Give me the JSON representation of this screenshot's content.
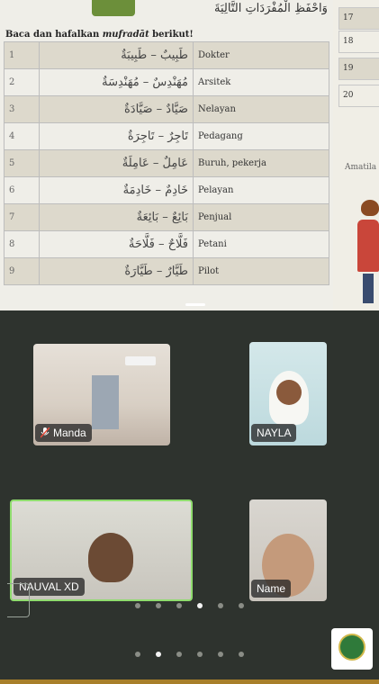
{
  "book": {
    "arabic_header": "وَاحْفَظِ الْمُفْرَدَاتِ التَّالِيَةَ",
    "instruction_prefix": "Baca dan hafalkan ",
    "instruction_term": "mufradāt",
    "instruction_suffix": " berikut!",
    "rows": [
      {
        "num": "1",
        "arabic": "طَبِيبٌ – طَبِيبَةٌ",
        "meaning": "Dokter"
      },
      {
        "num": "2",
        "arabic": "مُهَنْدِسٌ – مُهَنْدِسَةٌ",
        "meaning": "Arsitek"
      },
      {
        "num": "3",
        "arabic": "صَيَّادٌ – صَيَّادَةٌ",
        "meaning": "Nelayan"
      },
      {
        "num": "4",
        "arabic": "تَاجِرٌ – تَاجِرَةٌ",
        "meaning": "Pedagang"
      },
      {
        "num": "5",
        "arabic": "عَامِلٌ – عَامِلَةٌ",
        "meaning": "Buruh, pekerja"
      },
      {
        "num": "6",
        "arabic": "خَادِمٌ – خَادِمَةٌ",
        "meaning": "Pelayan"
      },
      {
        "num": "7",
        "arabic": "بَائِعٌ – بَائِعَةٌ",
        "meaning": "Penjual"
      },
      {
        "num": "8",
        "arabic": "فَلَّاحٌ – فَلَّاحَةٌ",
        "meaning": "Petani"
      },
      {
        "num": "9",
        "arabic": "طَيَّارٌ – طَيَّارَةٌ",
        "meaning": "Pilot"
      }
    ],
    "right_numbers": [
      "17",
      "18",
      "19",
      "20"
    ],
    "amatilah": "Amatila"
  },
  "participants": [
    {
      "name": "Manda",
      "muted": true
    },
    {
      "name": "NAYLA",
      "muted": false
    },
    {
      "name": "NAUVAL XD",
      "muted": false,
      "active_speaker": true
    },
    {
      "name": "Name",
      "muted": false
    }
  ],
  "pagination": {
    "top_dots": 6,
    "top_active": 3,
    "bottom_dots": 6,
    "bottom_active": 1
  },
  "colors": {
    "active_speaker_border": "#8fdc6e",
    "gallery_bg": "#2e332e"
  }
}
